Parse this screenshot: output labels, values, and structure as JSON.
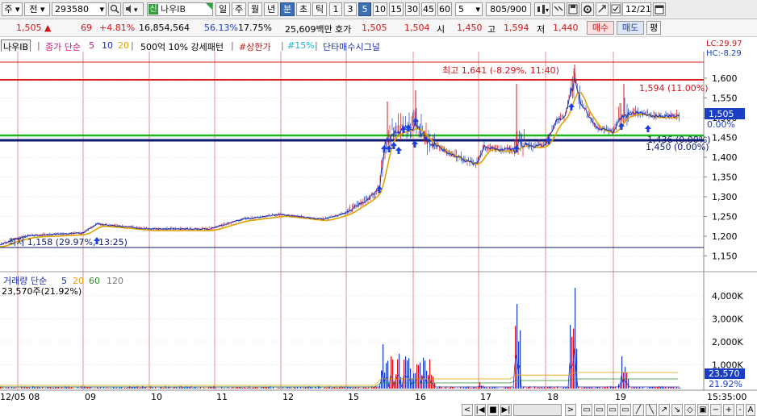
{
  "toolbar": {
    "market": "주",
    "market_suffix": "전",
    "code": "293580",
    "name_badge": "신",
    "name": "나우IB",
    "periods": [
      "일",
      "주",
      "월",
      "년",
      "분",
      "초",
      "틱"
    ],
    "active_period": "분",
    "intervals": [
      "1",
      "3",
      "5",
      "10",
      "15",
      "30",
      "45",
      "60"
    ],
    "active_interval": "5",
    "interval_value": "5",
    "count": "805/900",
    "date": "12/21"
  },
  "info": {
    "price": "1,505",
    "change": "69",
    "change_pct": "+4.81%",
    "volume": "16,854,564",
    "vol_ratio": "56.13%",
    "turnover": "17.75%",
    "amount": "25,609백만",
    "quote_label": "호가",
    "ask": "1,505",
    "bid": "1,504",
    "open_label": "시",
    "open": "1,450",
    "high_label": "고",
    "high": "1,594",
    "low_label": "저",
    "low": "1,440",
    "buy_label": "매수",
    "sell_label": "매도",
    "eval_label": "평"
  },
  "legend": {
    "name": "나우IB",
    "ma_label": "종가 단순",
    "ma5": "5",
    "ma10": "10",
    "ma20": "20",
    "pattern": "500억 10% 강세패턴",
    "upper_limit": "#상한가",
    "pct15": "#15%",
    "signal": "단타매수시그널",
    "lc": "LC:29.97",
    "hc": "HC:-8.29"
  },
  "price_chart": {
    "y_ticks": [
      "1,600",
      "1,550",
      "1,500",
      "1,450",
      "1,400",
      "1,350",
      "1,300",
      "1,250",
      "1,200",
      "1,150"
    ],
    "high_annotation": "최고 1,641 (-8.29%, 11:40)",
    "upper_annotation": "1,594 (11.00%)",
    "low_annotation": "최저 1,158 (29.97%, 13:25)",
    "base_annotation": "1,450 (0.00%)",
    "base_annotation_2": "1,436 (0.00%)",
    "current_tag": "1,505",
    "current_pct": "0.00%"
  },
  "volume_chart": {
    "legend_label": "거래량 단순",
    "ma5": "5",
    "ma20": "20",
    "ma60": "60",
    "ma120": "120",
    "current": "23,570주(21.92%)",
    "y_ticks": [
      "4,000K",
      "3,000K",
      "2,000K",
      "1,000K"
    ],
    "current_tag": "23,570",
    "current_pct": "21.92%"
  },
  "x_axis": {
    "labels": [
      "12/05 08",
      "09",
      "10",
      "11",
      "12",
      "15",
      "16",
      "17",
      "18",
      "19"
    ],
    "time": "15:35:00"
  },
  "colors": {
    "up": "#d4141a",
    "down": "#1a3fc4",
    "ma5": "#1a2fb0",
    "ma20": "#e0a000",
    "green_line": "#1db51d",
    "navy_line": "#0c1a70",
    "red_line": "#d82020"
  }
}
